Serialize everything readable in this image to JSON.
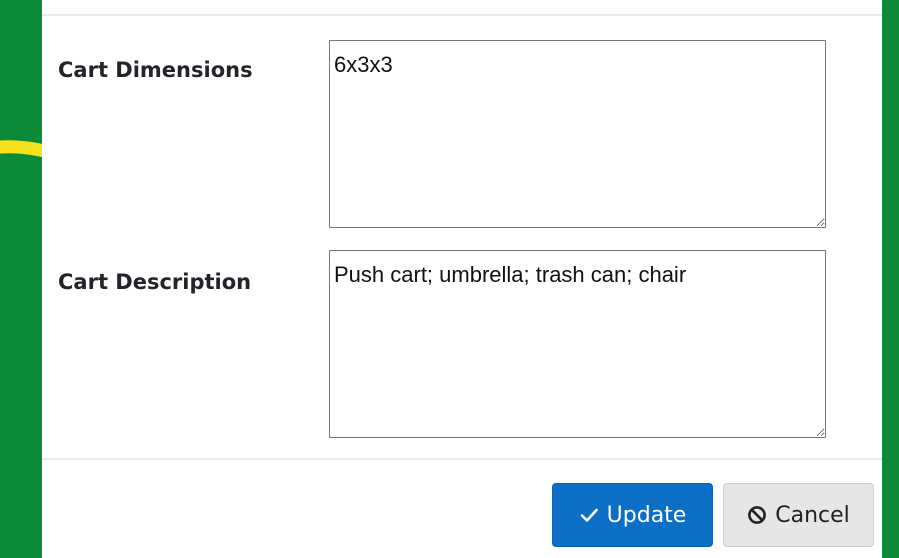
{
  "form": {
    "cart_dimensions_label": "Cart Dimensions",
    "cart_dimensions_value": "6x3x3",
    "cart_description_label": "Cart Description",
    "cart_description_value": "Push cart; umbrella; trash can; chair"
  },
  "footer": {
    "update_label": "Update",
    "update_icon": "checkmark-icon",
    "cancel_label": "Cancel",
    "cancel_icon": "ban-icon"
  },
  "colors": {
    "background": "#0b8a38",
    "arrow": "#f7e11a",
    "primary": "#0b6fc6",
    "secondary": "#e6e6e6"
  }
}
